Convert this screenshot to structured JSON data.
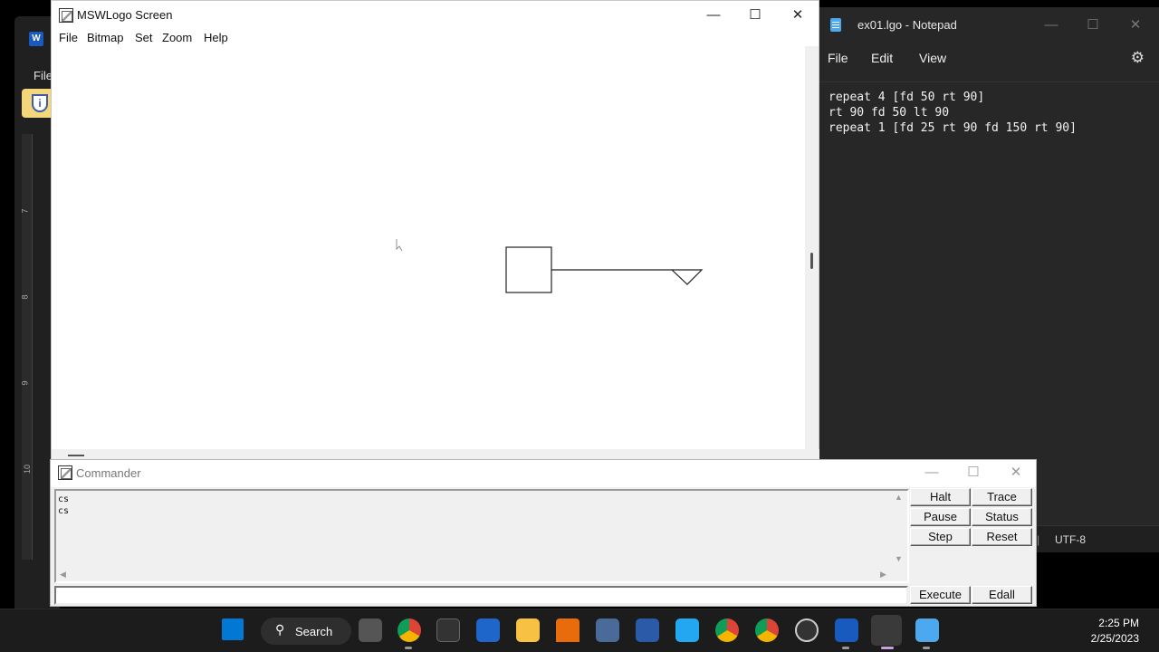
{
  "word": {
    "file_menu": "File",
    "ruler_numbers": [
      "7",
      "8",
      "9",
      "10"
    ]
  },
  "logo_screen": {
    "title": "MSWLogo Screen",
    "menu": [
      "File",
      "Bitmap",
      "Set",
      "Zoom",
      "Help"
    ],
    "controls": {
      "minimize": "—",
      "maximize": "☐",
      "close": "✕"
    },
    "drawing_color": "#000000"
  },
  "notepad": {
    "title": "ex01.lgo - Notepad",
    "menu": [
      "File",
      "Edit",
      "View"
    ],
    "settings_icon": "⚙",
    "lines": [
      "repeat 4 [fd 50 rt 90]",
      "rt 90 fd 50 lt 90",
      "repeat 1 [fd 25 rt 90 fd 150 rt 90]"
    ],
    "status": {
      "encoding": "UTF-8"
    },
    "controls": {
      "minimize": "—",
      "maximize": "☐",
      "close": "✕"
    }
  },
  "commander": {
    "title": "Commander",
    "output_lines": [
      "cs",
      "cs"
    ],
    "input_value": "",
    "buttons": {
      "halt": "Halt",
      "trace": "Trace",
      "pause": "Pause",
      "status": "Status",
      "step": "Step",
      "reset": "Reset",
      "execute": "Execute",
      "edall": "Edall"
    },
    "controls": {
      "minimize": "—",
      "maximize": "☐",
      "close": "✕"
    }
  },
  "taskbar": {
    "search_label": "Search",
    "search_icon": "⚲",
    "time": "2:25 PM",
    "date": "2/25/2023",
    "apps": [
      "start",
      "task-view",
      "chrome",
      "terminal",
      "photos",
      "file-explorer",
      "vlc",
      "calculator",
      "powershell",
      "vscode",
      "chrome-profile-2",
      "chrome-profile-3",
      "obs",
      "word",
      "mswlogo",
      "notepad"
    ],
    "colors": {
      "accent": "#0078d4"
    }
  }
}
